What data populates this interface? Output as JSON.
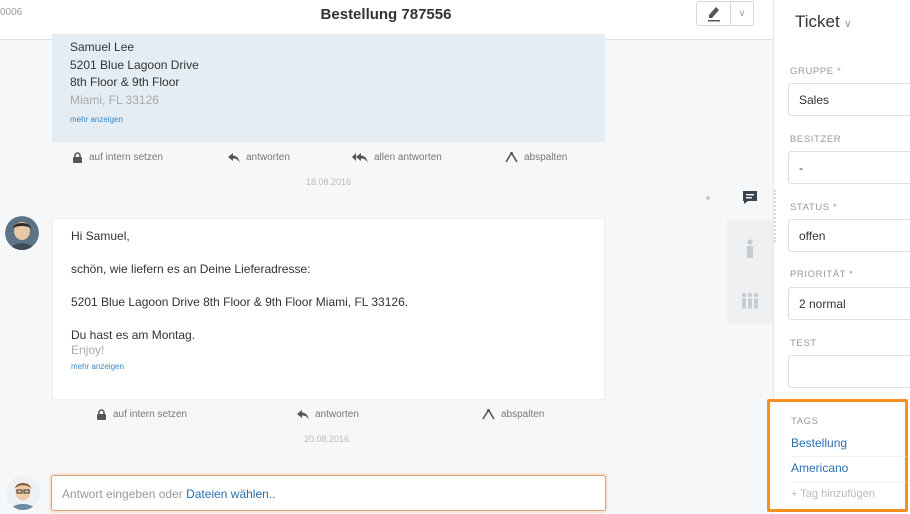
{
  "header": {
    "ticket_number": "0006",
    "title": "Bestellung 787556"
  },
  "articles": {
    "internal": {
      "address_lines": [
        "Samuel Lee",
        "5201 Blue Lagoon Drive",
        "8th Floor & 9th Floor"
      ],
      "address_faded": "Miami, FL 33126",
      "more": "mehr anzeigen"
    },
    "actions1": {
      "internal": "auf intern setzen",
      "reply": "antworten",
      "reply_all": "allen antworten",
      "split": "abspalten"
    },
    "date1": "18.08.2016",
    "message": {
      "greeting": "Hi Samuel,",
      "line1": "schön, wie liefern es an Deine Lieferadresse:",
      "line2": "5201 Blue Lagoon Drive 8th Floor & 9th Floor Miami, FL 33126.",
      "line3": "Du hast es am Montag.",
      "line4": "Enjoy!",
      "more": "mehr anzeigen"
    },
    "actions2": {
      "internal": "auf intern setzen",
      "reply": "antworten",
      "split": "abspalten"
    },
    "date2": "20.08.2016"
  },
  "reply": {
    "prefix": "Antwort eingeben oder",
    "link": "Dateien wählen.."
  },
  "sidebar": {
    "title": "Ticket",
    "fields": {
      "group_label": "GRUPPE *",
      "group_value": "Sales",
      "owner_label": "BESITZER",
      "owner_value": "-",
      "status_label": "STATUS *",
      "status_value": "offen",
      "priority_label": "PRIORITÄT *",
      "priority_value": "2 normal",
      "test_label": "TEST",
      "test_value": ""
    },
    "tags": {
      "label": "TAGS",
      "items": [
        "Bestellung",
        "Americano"
      ],
      "add": "+ Tag hinzufügen"
    }
  },
  "colors": {
    "accent": "#2b6fae",
    "highlight": "#f7901e",
    "internal_bg": "#e3edf3"
  }
}
